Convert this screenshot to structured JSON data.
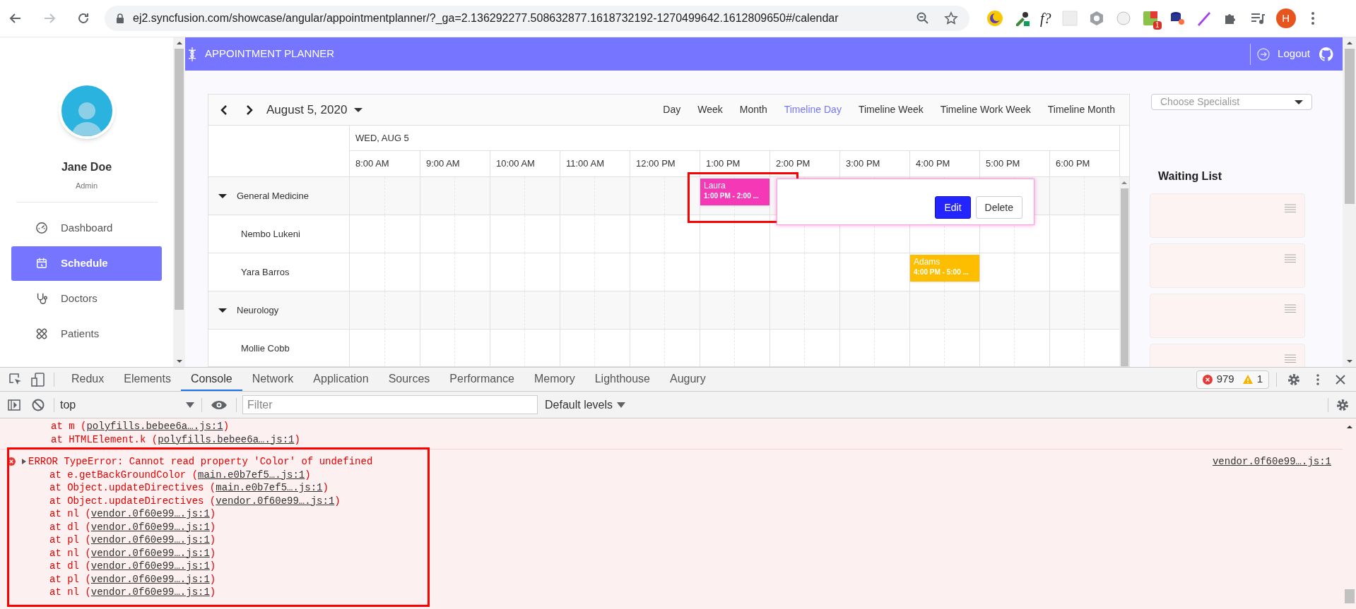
{
  "browser": {
    "url": "ej2.syncfusion.com/showcase/angular/appointmentplanner/?_ga=2.136292277.508632877.1618732192-1270499642.1612809650#/calendar",
    "extension_text": "f?",
    "extension_badge": "1",
    "profile_initial": "H"
  },
  "header": {
    "title": "APPOINTMENT PLANNER",
    "logout": "Logout"
  },
  "user": {
    "name": "Jane Doe",
    "role": "Admin"
  },
  "nav": [
    {
      "label": "Dashboard",
      "selected": false
    },
    {
      "label": "Schedule",
      "selected": true
    },
    {
      "label": "Doctors",
      "selected": false
    },
    {
      "label": "Patients",
      "selected": false
    }
  ],
  "scheduler": {
    "date": "August 5, 2020",
    "views": [
      {
        "label": "Day",
        "selected": false
      },
      {
        "label": "Week",
        "selected": false
      },
      {
        "label": "Month",
        "selected": false
      },
      {
        "label": "Timeline Day",
        "selected": true
      },
      {
        "label": "Timeline Week",
        "selected": false
      },
      {
        "label": "Timeline Work Week",
        "selected": false
      },
      {
        "label": "Timeline Month",
        "selected": false
      }
    ],
    "day_header": "WED, AUG 5",
    "hours": [
      "8:00 AM",
      "9:00 AM",
      "10:00 AM",
      "11:00 AM",
      "12:00 PM",
      "1:00 PM",
      "2:00 PM",
      "3:00 PM",
      "4:00 PM",
      "5:00 PM",
      "6:00 PM"
    ],
    "resources": [
      {
        "label": "General Medicine",
        "expanded": true,
        "events": [
          {
            "title": "Laura",
            "time": "1:00 PM - 2:00 ...",
            "color": "#f538b6",
            "popup": {
              "buttons": [
                {
                  "label": "Edit",
                  "primary": true
                },
                {
                  "label": "Delete",
                  "primary": false
                }
              ]
            }
          }
        ],
        "children": [
          {
            "label": "Nembo Lukeni"
          },
          {
            "label": "Yara Barros",
            "events": [
              {
                "title": "Adams",
                "time": "4:00 PM - 5:00 ...",
                "color": "#fdbe00"
              }
            ]
          }
        ]
      },
      {
        "label": "Neurology",
        "expanded": true,
        "children": [
          {
            "label": "Mollie Cobb"
          }
        ]
      }
    ]
  },
  "specialist": {
    "placeholder": "Choose Specialist"
  },
  "waiting_list": {
    "title": "Waiting List",
    "cards": [
      {
        "kind": "empty"
      },
      {
        "kind": "empty"
      },
      {
        "kind": "empty"
      },
      {
        "kind": "empty"
      }
    ]
  },
  "devtools": {
    "tabs": [
      {
        "label": "Redux",
        "selected": false
      },
      {
        "label": "Elements",
        "selected": false
      },
      {
        "label": "Console",
        "selected": true
      },
      {
        "label": "Network",
        "selected": false
      },
      {
        "label": "Application",
        "selected": false
      },
      {
        "label": "Sources",
        "selected": false
      },
      {
        "label": "Performance",
        "selected": false
      },
      {
        "label": "Memory",
        "selected": false
      },
      {
        "label": "Lighthouse",
        "selected": false
      },
      {
        "label": "Augury",
        "selected": false
      }
    ],
    "errors": "979",
    "warnings": "1",
    "context": "top",
    "filter_placeholder": "Filter",
    "levels": "Default levels",
    "console": [
      {
        "kind": "stack",
        "lines": [
          {
            "prefix": "at m (",
            "link": "polyfills.bebee6a….js:1",
            "suffix": ")"
          },
          {
            "prefix": "at HTMLElement.k (",
            "link": "polyfills.bebee6a….js:1",
            "suffix": ")"
          }
        ]
      },
      {
        "kind": "error",
        "expanded": false,
        "message": "ERROR TypeError: Cannot read property 'Color' of undefined",
        "source": "vendor.0f60e99….js:1",
        "lines": [
          {
            "prefix": "at e.getBackGroundColor (",
            "link": "main.e0b7ef5….js:1",
            "suffix": ")"
          },
          {
            "prefix": "at Object.updateDirectives (",
            "link": "main.e0b7ef5….js:1",
            "suffix": ")"
          },
          {
            "prefix": "at Object.updateDirectives (",
            "link": "vendor.0f60e99….js:1",
            "suffix": ")"
          },
          {
            "prefix": "at nl (",
            "link": "vendor.0f60e99….js:1",
            "suffix": ")"
          },
          {
            "prefix": "at dl (",
            "link": "vendor.0f60e99….js:1",
            "suffix": ")"
          },
          {
            "prefix": "at pl (",
            "link": "vendor.0f60e99….js:1",
            "suffix": ")"
          },
          {
            "prefix": "at nl (",
            "link": "vendor.0f60e99….js:1",
            "suffix": ")"
          },
          {
            "prefix": "at dl (",
            "link": "vendor.0f60e99….js:1",
            "suffix": ")"
          },
          {
            "prefix": "at pl (",
            "link": "vendor.0f60e99….js:1",
            "suffix": ")"
          },
          {
            "prefix": "at nl (",
            "link": "vendor.0f60e99….js:1",
            "suffix": ")"
          }
        ]
      }
    ]
  }
}
